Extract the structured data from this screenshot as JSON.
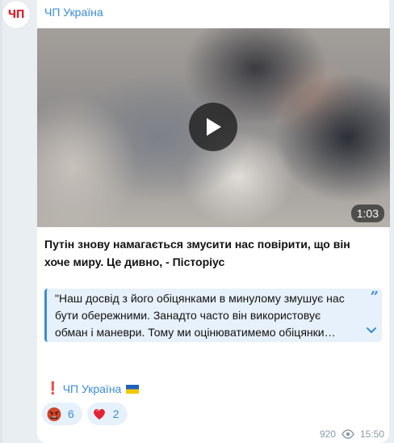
{
  "channel": {
    "avatar_text": "ЧП",
    "name": "ЧП Україна"
  },
  "video": {
    "duration": "1:03"
  },
  "message": {
    "headline": "Путін знову намагається змусити нас повірити, що він хоче миру. Це дивно, - Пісторіус",
    "quote_lines": "\"Наш досвід з його обіцянками в минулому змушує нас\nбути обережними. Занадто часто він використовує\nобман і маневри. Тому ми оцінюватимемо обіцянки…",
    "quote_mark": "”",
    "signature_exclamation": "❗",
    "signature_name": "ЧП Україна"
  },
  "reactions": [
    {
      "emoji": "angry-face",
      "count": "6"
    },
    {
      "emoji": "red-heart",
      "count": "2"
    }
  ],
  "footer": {
    "views": "920",
    "time": "15:50"
  },
  "colors": {
    "accent": "#3a8bd8",
    "logo_red": "#e0242f",
    "flag_blue": "#1f5fbf",
    "flag_yellow": "#f2c900",
    "heart": "#e32234"
  }
}
